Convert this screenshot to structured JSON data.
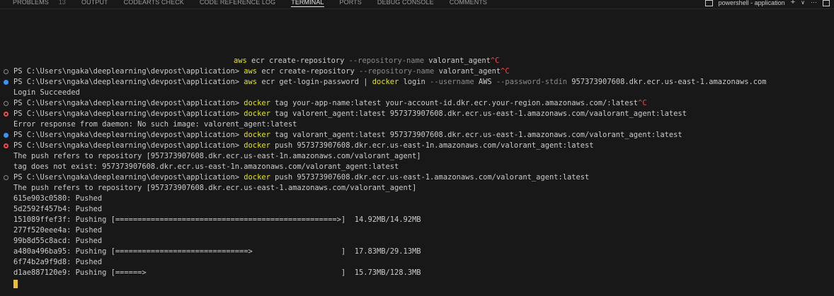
{
  "panel_tabs": [
    {
      "label": "PROBLEMS",
      "badge": "13",
      "active": false
    },
    {
      "label": "OUTPUT",
      "active": false
    },
    {
      "label": "CODEARTS CHECK",
      "active": false
    },
    {
      "label": "CODE REFERENCE LOG",
      "active": false
    },
    {
      "label": "TERMINAL",
      "active": true
    },
    {
      "label": "PORTS",
      "active": false
    },
    {
      "label": "DEBUG CONSOLE",
      "active": false
    },
    {
      "label": "COMMENTS",
      "active": false
    }
  ],
  "terminal_instance": {
    "label": "powershell - application",
    "add": "+",
    "dropdown": "∨",
    "more": "···"
  },
  "colors": {
    "background": "#181818",
    "text": "#cccccc",
    "command": "#e5e510",
    "param": "#8a8a8a",
    "interrupt": "#f14c4c",
    "status_ok": "#3794ff",
    "status_error": "#f14c4c",
    "cursor": "#e8c02c"
  },
  "lines": [
    {
      "status": "none",
      "indent": true,
      "segments": [
        {
          "t": "aws",
          "c": "y"
        },
        {
          "t": " ecr create-repository ",
          "c": "w"
        },
        {
          "t": "--repository-name",
          "c": "g"
        },
        {
          "t": " valorant_agent",
          "c": "w"
        },
        {
          "t": "^C",
          "c": "r"
        }
      ]
    },
    {
      "status": "idle",
      "segments": [
        {
          "t": "PS C:\\Users\\ngaka\\deeplearning\\devpost\\application> ",
          "c": "w"
        },
        {
          "t": "aws",
          "c": "y"
        },
        {
          "t": " ecr create-repository ",
          "c": "w"
        },
        {
          "t": "--repository-name",
          "c": "g"
        },
        {
          "t": " valorant_agent",
          "c": "w"
        },
        {
          "t": "^C",
          "c": "r"
        }
      ]
    },
    {
      "status": "ok",
      "segments": [
        {
          "t": "PS C:\\Users\\ngaka\\deeplearning\\devpost\\application> ",
          "c": "w"
        },
        {
          "t": "aws",
          "c": "y"
        },
        {
          "t": " ecr get-login-password | ",
          "c": "w"
        },
        {
          "t": "docker",
          "c": "y"
        },
        {
          "t": " login ",
          "c": "w"
        },
        {
          "t": "--username",
          "c": "g"
        },
        {
          "t": " AWS ",
          "c": "w"
        },
        {
          "t": "--password-stdin",
          "c": "g"
        },
        {
          "t": " 957373907608.dkr.ecr.us-east-1.amazonaws.com",
          "c": "w"
        }
      ]
    },
    {
      "status": "none",
      "segments": [
        {
          "t": "Login Succeeded",
          "c": "w"
        }
      ]
    },
    {
      "status": "idle",
      "segments": [
        {
          "t": "PS C:\\Users\\ngaka\\deeplearning\\devpost\\application> ",
          "c": "w"
        },
        {
          "t": "docker",
          "c": "y"
        },
        {
          "t": " tag your-app-name:latest your-account-id.dkr.ecr.your-region.amazonaws.com/:latest",
          "c": "w"
        },
        {
          "t": "^C",
          "c": "r"
        }
      ]
    },
    {
      "status": "error",
      "segments": [
        {
          "t": "PS C:\\Users\\ngaka\\deeplearning\\devpost\\application> ",
          "c": "w"
        },
        {
          "t": "docker",
          "c": "y"
        },
        {
          "t": " tag valorent_agent:latest 957373907608.dkr.ecr.us-east-1.amazonaws.com/vaalorant_agent:latest",
          "c": "w"
        }
      ]
    },
    {
      "status": "none",
      "segments": [
        {
          "t": "Error response from daemon: No such image: valorent_agent:latest",
          "c": "w"
        }
      ]
    },
    {
      "status": "ok",
      "segments": [
        {
          "t": "PS C:\\Users\\ngaka\\deeplearning\\devpost\\application> ",
          "c": "w"
        },
        {
          "t": "docker",
          "c": "y"
        },
        {
          "t": " tag valorant_agent:latest 957373907608.dkr.ecr.us-east-1.amazonaws.com/valorant_agent:latest",
          "c": "w"
        }
      ]
    },
    {
      "status": "error",
      "segments": [
        {
          "t": "PS C:\\Users\\ngaka\\deeplearning\\devpost\\application> ",
          "c": "w"
        },
        {
          "t": "docker",
          "c": "y"
        },
        {
          "t": " push 957373907608.dkr.ecr.us-east-1n.amazonaws.com/valorant_agent:latest",
          "c": "w"
        }
      ]
    },
    {
      "status": "none",
      "segments": [
        {
          "t": "The push refers to repository [957373907608.dkr.ecr.us-east-1n.amazonaws.com/valorant_agent]",
          "c": "w"
        }
      ]
    },
    {
      "status": "none",
      "segments": [
        {
          "t": "tag does not exist: 957373907608.dkr.ecr.us-east-1n.amazonaws.com/valorant_agent:latest",
          "c": "w"
        }
      ]
    },
    {
      "status": "idle",
      "segments": [
        {
          "t": "PS C:\\Users\\ngaka\\deeplearning\\devpost\\application> ",
          "c": "w"
        },
        {
          "t": "docker",
          "c": "y"
        },
        {
          "t": " push 957373907608.dkr.ecr.us-east-1.amazonaws.com/valorant_agent:latest",
          "c": "w"
        }
      ]
    },
    {
      "status": "none",
      "segments": [
        {
          "t": "The push refers to repository [957373907608.dkr.ecr.us-east-1.amazonaws.com/valorant_agent]",
          "c": "w"
        }
      ]
    },
    {
      "status": "none",
      "segments": [
        {
          "t": "615e903c0580: Pushed",
          "c": "w"
        }
      ]
    },
    {
      "status": "none",
      "segments": [
        {
          "t": "5d2592f457b4: Pushed",
          "c": "w"
        }
      ]
    },
    {
      "status": "none",
      "segments": [
        {
          "t": "151089ffef3f: Pushing [==================================================>]  14.92MB/14.92MB",
          "c": "w"
        }
      ]
    },
    {
      "status": "none",
      "segments": [
        {
          "t": "277f520eee4a: Pushed",
          "c": "w"
        }
      ]
    },
    {
      "status": "none",
      "segments": [
        {
          "t": "99b8d55c8acd: Pushed",
          "c": "w"
        }
      ]
    },
    {
      "status": "none",
      "segments": [
        {
          "t": "a480a496ba95: Pushing [==============================>                    ]  17.83MB/29.13MB",
          "c": "w"
        }
      ]
    },
    {
      "status": "none",
      "segments": [
        {
          "t": "6f74b2a9f9d8: Pushed",
          "c": "w"
        }
      ]
    },
    {
      "status": "none",
      "segments": [
        {
          "t": "d1ae887120e9: Pushing [======>                                            ]  15.73MB/128.3MB",
          "c": "w"
        }
      ]
    }
  ]
}
